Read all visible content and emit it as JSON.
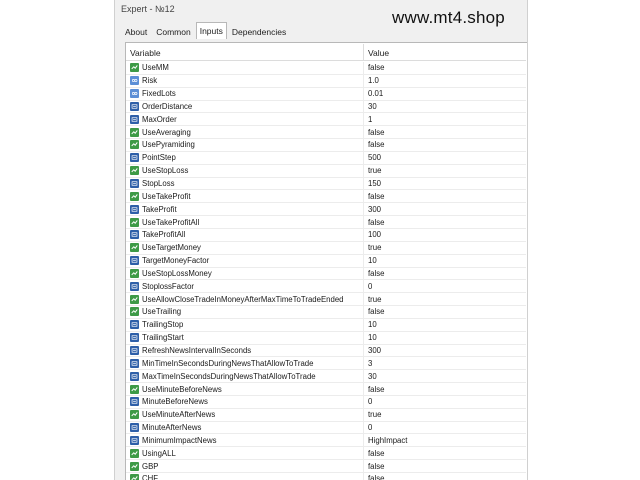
{
  "window": {
    "title": "Expert - №12"
  },
  "watermark": "www.mt4.shop",
  "tabs": [
    {
      "label": "About"
    },
    {
      "label": "Common"
    },
    {
      "label": "Inputs",
      "active": true
    },
    {
      "label": "Dependencies"
    }
  ],
  "grid": {
    "col_variable": "Variable",
    "col_value": "Value",
    "rows": [
      {
        "name": "UseMM",
        "value": "false",
        "type": "bool"
      },
      {
        "name": "Risk",
        "value": "1.0",
        "type": "double"
      },
      {
        "name": "FixedLots",
        "value": "0.01",
        "type": "double"
      },
      {
        "name": "OrderDistance",
        "value": "30",
        "type": "int"
      },
      {
        "name": "MaxOrder",
        "value": "1",
        "type": "int"
      },
      {
        "name": "UseAveraging",
        "value": "false",
        "type": "bool"
      },
      {
        "name": "UsePyramiding",
        "value": "false",
        "type": "bool"
      },
      {
        "name": "PointStep",
        "value": "500",
        "type": "int"
      },
      {
        "name": "UseStopLoss",
        "value": "true",
        "type": "bool"
      },
      {
        "name": "StopLoss",
        "value": "150",
        "type": "int"
      },
      {
        "name": "UseTakeProfit",
        "value": "false",
        "type": "bool"
      },
      {
        "name": "TakeProfit",
        "value": "300",
        "type": "int"
      },
      {
        "name": "UseTakeProfitAll",
        "value": "false",
        "type": "bool"
      },
      {
        "name": "TakeProfitAll",
        "value": "100",
        "type": "int"
      },
      {
        "name": "UseTargetMoney",
        "value": "true",
        "type": "bool"
      },
      {
        "name": "TargetMoneyFactor",
        "value": "10",
        "type": "int"
      },
      {
        "name": "UseStopLossMoney",
        "value": "false",
        "type": "bool"
      },
      {
        "name": "StoplossFactor",
        "value": "0",
        "type": "int"
      },
      {
        "name": "UseAllowCloseTradeInMoneyAfterMaxTimeToTradeEnded",
        "value": "true",
        "type": "bool"
      },
      {
        "name": "UseTrailing",
        "value": "false",
        "type": "bool"
      },
      {
        "name": "TrailingStop",
        "value": "10",
        "type": "int"
      },
      {
        "name": "TrailingStart",
        "value": "10",
        "type": "int"
      },
      {
        "name": "RefreshNewsIntervalInSeconds",
        "value": "300",
        "type": "int"
      },
      {
        "name": "MinTimeInSecondsDuringNewsThatAllowToTrade",
        "value": "3",
        "type": "int"
      },
      {
        "name": "MaxTimeInSecondsDuringNewsThatAllowToTrade",
        "value": "30",
        "type": "int"
      },
      {
        "name": "UseMinuteBeforeNews",
        "value": "false",
        "type": "bool"
      },
      {
        "name": "MinuteBeforeNews",
        "value": "0",
        "type": "int"
      },
      {
        "name": "UseMinuteAfterNews",
        "value": "true",
        "type": "bool"
      },
      {
        "name": "MinuteAfterNews",
        "value": "0",
        "type": "int"
      },
      {
        "name": "MinimumImpactNews",
        "value": "HighImpact",
        "type": "int"
      },
      {
        "name": "UsingALL",
        "value": "false",
        "type": "bool"
      },
      {
        "name": "GBP",
        "value": "false",
        "type": "bool"
      },
      {
        "name": "CHF",
        "value": "false",
        "type": "bool"
      }
    ]
  },
  "colors": {
    "bool_icon": "#3d9a46",
    "int_icon": "#2e5fa8",
    "double_icon": "#5c8fd6"
  }
}
